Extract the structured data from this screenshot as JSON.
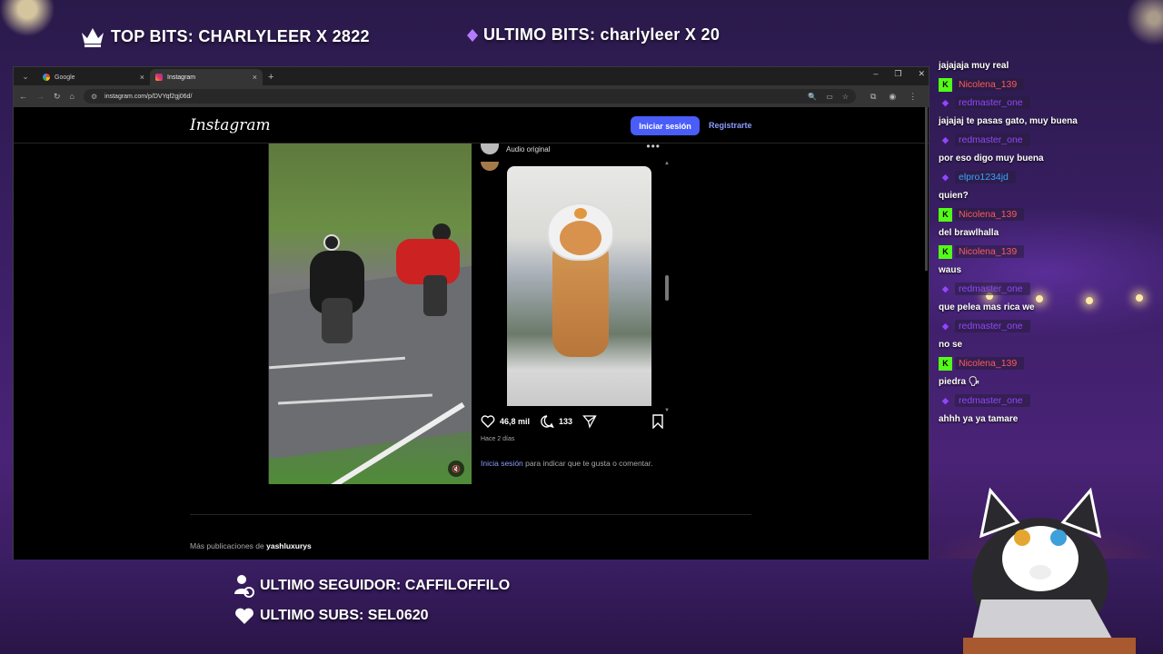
{
  "overlay": {
    "top_bits": "TOP BITS: CHARLYLEER X 2822",
    "ultimo_bits": "ULTIMO BITS: charlyleer X 20",
    "ultimo_seguidor": "ULTIMO SEGUIDOR: CAFFILOFFILO",
    "ultimo_subs": "ULTIMO SUBS: SEL0620"
  },
  "browser": {
    "tabs": [
      {
        "label": "Google",
        "icon": "google-favicon"
      },
      {
        "label": "Instagram",
        "icon": "instagram-favicon",
        "active": true
      }
    ],
    "url": "instagram.com/p/DVYqf2gj06d/"
  },
  "instagram": {
    "logo": "Instagram",
    "login_button": "Iniciar sesión",
    "register_link": "Registrarte",
    "post": {
      "audio": "Audio original",
      "likes": "46,8 mil",
      "comments": "133",
      "time_ago": "Hace 2 días",
      "login_link": "Inicia sesión",
      "login_prompt_rest": " para indicar que te gusta o comentar."
    },
    "more_posts_prefix": "Más publicaciones de ",
    "more_posts_user": "yashluxurys"
  },
  "chat": [
    {
      "type": "text",
      "text": "jajajaja muy real"
    },
    {
      "type": "user",
      "name": "Nicolena_139",
      "color": "#ff5a5a",
      "badge": "K"
    },
    {
      "type": "user",
      "name": "redmaster_one",
      "color": "#9146ff",
      "badge": "bits"
    },
    {
      "type": "text",
      "text": "jajajaj te pasas gato, muy buena"
    },
    {
      "type": "user",
      "name": "redmaster_one",
      "color": "#9146ff",
      "badge": "bits"
    },
    {
      "type": "text",
      "text": "por eso digo muy buena"
    },
    {
      "type": "user",
      "name": "elpro1234jd",
      "color": "#3ba3ff",
      "badge": "bits"
    },
    {
      "type": "text",
      "text": "quien?"
    },
    {
      "type": "user",
      "name": "Nicolena_139",
      "color": "#ff5a5a",
      "badge": "K"
    },
    {
      "type": "text",
      "text": "del brawlhalla"
    },
    {
      "type": "user",
      "name": "Nicolena_139",
      "color": "#ff5a5a",
      "badge": "K"
    },
    {
      "type": "text",
      "text": "waus"
    },
    {
      "type": "user",
      "name": "redmaster_one",
      "color": "#9146ff",
      "badge": "bits"
    },
    {
      "type": "text",
      "text": "que pelea mas rica we"
    },
    {
      "type": "user",
      "name": "redmaster_one",
      "color": "#9146ff",
      "badge": "bits"
    },
    {
      "type": "text",
      "text": "no se"
    },
    {
      "type": "user",
      "name": "Nicolena_139",
      "color": "#ff5a5a",
      "badge": "K"
    },
    {
      "type": "text",
      "text": "piedra 🗣"
    },
    {
      "type": "user",
      "name": "redmaster_one",
      "color": "#9146ff",
      "badge": "bits"
    },
    {
      "type": "text",
      "text": "ahhh ya ya tamare"
    }
  ],
  "colors": {
    "ig_blue": "#4a5df9",
    "kick_green": "#53fc18",
    "twitch_purple": "#9146ff"
  }
}
